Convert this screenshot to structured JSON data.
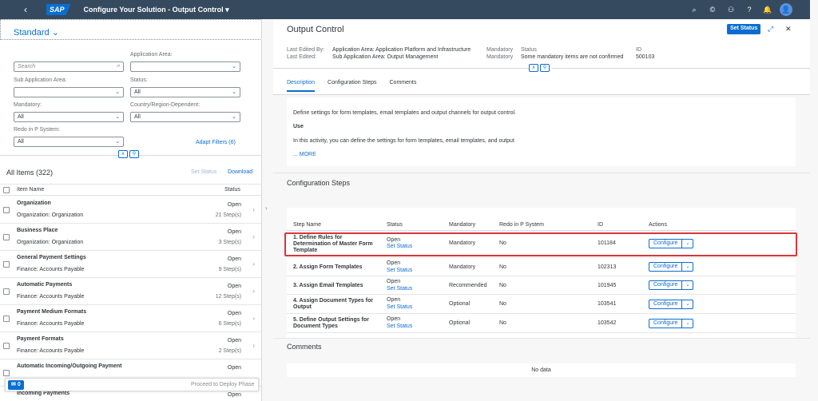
{
  "shell": {
    "back_icon": "‹",
    "logo": "SAP",
    "title": "Configure Your Solution - Output Control",
    "title_chevron": "▾",
    "icons": [
      "search-icon",
      "copilot-icon",
      "connect-icon",
      "help-icon",
      "notification-icon"
    ],
    "icon_glyphs": [
      "⌕",
      "©",
      "⚇",
      "?",
      "🔔"
    ],
    "avatar_glyph": "👤"
  },
  "left": {
    "variant": "Standard",
    "variant_chevron": "⌄",
    "filters": {
      "search_placeholder": "Search",
      "application_area_label": "Application Area:",
      "application_area_value": "",
      "sub_application_area_label": "Sub Application Area:",
      "sub_application_area_value": "",
      "status_label": "Status:",
      "status_value": "All",
      "mandatory_label": "Mandatory:",
      "mandatory_value": "All",
      "country_label": "Country/Region-Dependent:",
      "country_value": "All",
      "redo_label": "Redo in P System:",
      "redo_value": "All",
      "adapt_filters": "Adapt Filters (6)"
    },
    "list": {
      "title": "All Items (322)",
      "set_status": "Set Status",
      "download": "Download",
      "col_item_name": "Item Name",
      "col_status": "Status",
      "rows": [
        {
          "name": "Organization",
          "sub": "Organization: Organization",
          "status": "Open",
          "steps": "21 Step(s)"
        },
        {
          "name": "Business Place",
          "sub": "Organization: Organization",
          "status": "Open",
          "steps": "3 Step(s)"
        },
        {
          "name": "General Payment Settings",
          "sub": "Finance: Accounts Payable",
          "status": "Open",
          "steps": "9 Step(s)"
        },
        {
          "name": "Automatic Payments",
          "sub": "Finance: Accounts Payable",
          "status": "Open",
          "steps": "12 Step(s)"
        },
        {
          "name": "Payment Medium Formats",
          "sub": "Finance: Accounts Payable",
          "status": "Open",
          "steps": "6 Step(s)"
        },
        {
          "name": "Payment Formats",
          "sub": "Finance: Accounts Payable",
          "status": "Open",
          "steps": "2 Step(s)"
        },
        {
          "name": "Automatic Incoming/Outgoing Payment",
          "sub": "",
          "status": "Open",
          "steps": ""
        },
        {
          "name": "Incoming Payments",
          "sub": "",
          "status": "Open",
          "steps": ""
        }
      ]
    },
    "footer": {
      "messages": "0",
      "proceed": "Proceed to Deploy Phase"
    }
  },
  "right": {
    "title": "Output Control",
    "set_status": "Set Status",
    "last_edited_by_label": "Last Edited By:",
    "last_edited_label": "Last Edited:",
    "application_area": "Application Area: Application Platform and Infrastructure",
    "sub_application_area": "Sub Application Area: Output Management",
    "mandatory_label1": "Mandatory",
    "mandatory_label2": "Mandatory",
    "status_label": "Status",
    "status_value": "Some mandatory items are not confirmed",
    "id_label": "ID",
    "id_value": "500103",
    "tabs": [
      "Description",
      "Configuration Steps",
      "Comments"
    ],
    "description": {
      "line1": "Define settings for form templates, email templates and output channels for output control.",
      "use": "Use",
      "line2": "In this activity, you can define the settings for form templates, email templates, and output",
      "more": "... MORE"
    },
    "config_title": "Configuration Steps",
    "columns": [
      "Step Name",
      "Status",
      "Mandatory",
      "Redo in P System",
      "ID",
      "Actions"
    ],
    "steps": [
      {
        "name": "1. Define Rules for Determination of Master Form Template",
        "status": "Open",
        "set_status": "Set Status",
        "mandatory": "Mandatory",
        "redo": "No",
        "id": "101184",
        "action": "Configure"
      },
      {
        "name": "2. Assign Form Templates",
        "status": "Open",
        "set_status": "Set Status",
        "mandatory": "Mandatory",
        "redo": "No",
        "id": "102313",
        "action": "Configure"
      },
      {
        "name": "3. Assign Email Templates",
        "status": "Open",
        "set_status": "Set Status",
        "mandatory": "Recommended",
        "redo": "No",
        "id": "101945",
        "action": "Configure"
      },
      {
        "name": "4. Assign Document Types for Output",
        "status": "Open",
        "set_status": "Set Status",
        "mandatory": "Optional",
        "redo": "No",
        "id": "103541",
        "action": "Configure"
      },
      {
        "name": "5. Define Output Settings for Document Types",
        "status": "Open",
        "set_status": "Set Status",
        "mandatory": "Optional",
        "redo": "No",
        "id": "103542",
        "action": "Configure"
      }
    ],
    "comments_title": "Comments",
    "no_data": "No data"
  }
}
